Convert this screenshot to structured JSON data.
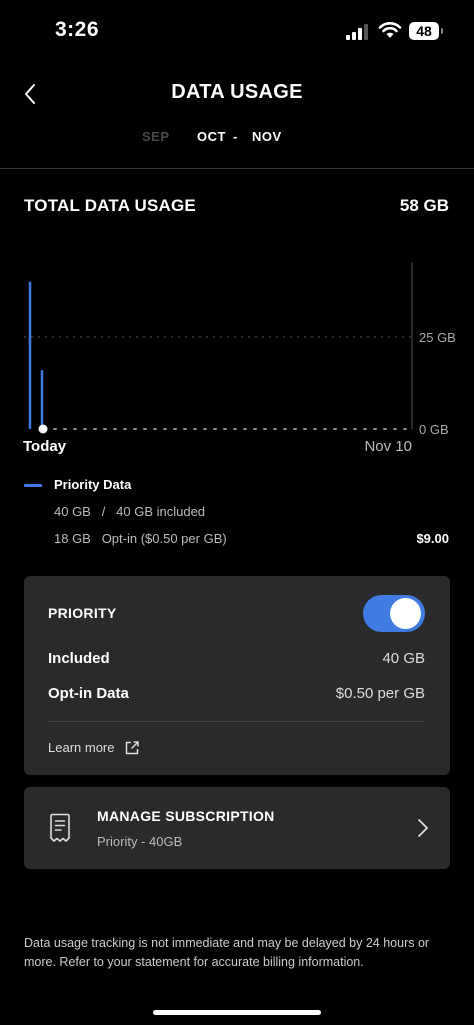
{
  "status": {
    "time": "3:26",
    "battery": "48"
  },
  "header": {
    "title": "DATA USAGE"
  },
  "months": {
    "prev": "SEP",
    "current": "OCT",
    "dash": "-",
    "next": "NOV"
  },
  "total": {
    "label": "TOTAL DATA USAGE",
    "value": "58 GB"
  },
  "chart_data": {
    "type": "bar",
    "y_ticks": [
      "25 GB",
      "0 GB"
    ],
    "x_start_label": "Today",
    "x_end_label": "Nov 10",
    "ylim": [
      0,
      40
    ],
    "series": [
      {
        "name": "Priority Data",
        "values": [
          40,
          16
        ],
        "color": "#3f7be0"
      }
    ],
    "grid": true
  },
  "legend": {
    "name": "Priority Data",
    "included_row": "40 GB   /   40 GB included",
    "optin_row": "18 GB   Opt-in ($0.50 per GB)",
    "optin_price": "$9.00"
  },
  "priority_card": {
    "title": "PRIORITY",
    "toggle_on": true,
    "included_label": "Included",
    "included_value": "40 GB",
    "optin_label": "Opt-in Data",
    "optin_value": "$0.50 per GB",
    "learn_more": "Learn more"
  },
  "subscription": {
    "title": "MANAGE SUBSCRIPTION",
    "detail": "Priority - 40GB"
  },
  "footnote": "Data usage tracking is not immediate and may be delayed by 24 hours or more. Refer to your statement for accurate billing information.",
  "colors": {
    "accent": "#3f7be0",
    "card": "#2a2a2c",
    "background": "#000000"
  }
}
